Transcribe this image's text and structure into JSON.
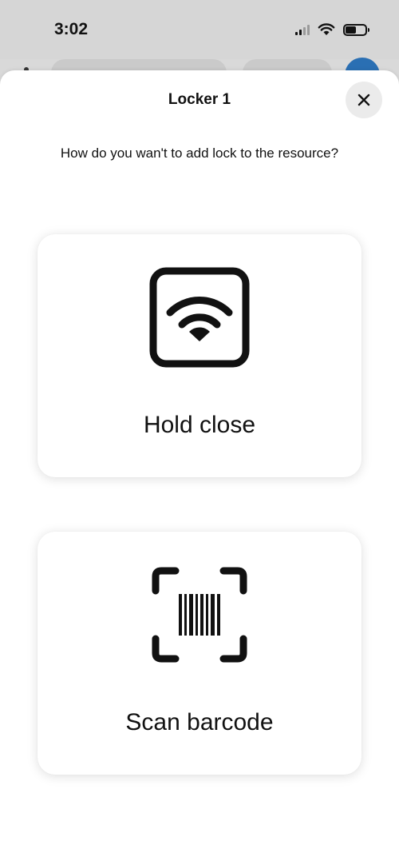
{
  "status_bar": {
    "time": "3:02",
    "icons": [
      "cellular-signal-icon",
      "wifi-icon",
      "battery-icon"
    ]
  },
  "sheet": {
    "title": "Locker 1",
    "close_icon": "close-icon",
    "prompt": "How do you wan't to add lock to the resource?"
  },
  "options": [
    {
      "label": "Hold close",
      "icon": "nfc-wireless-icon"
    },
    {
      "label": "Scan barcode",
      "icon": "barcode-scan-icon"
    }
  ],
  "colors": {
    "sheet_background": "#ffffff",
    "backdrop": "#d9d9d9",
    "close_button_bg": "#ebebeb",
    "text": "#111111"
  }
}
